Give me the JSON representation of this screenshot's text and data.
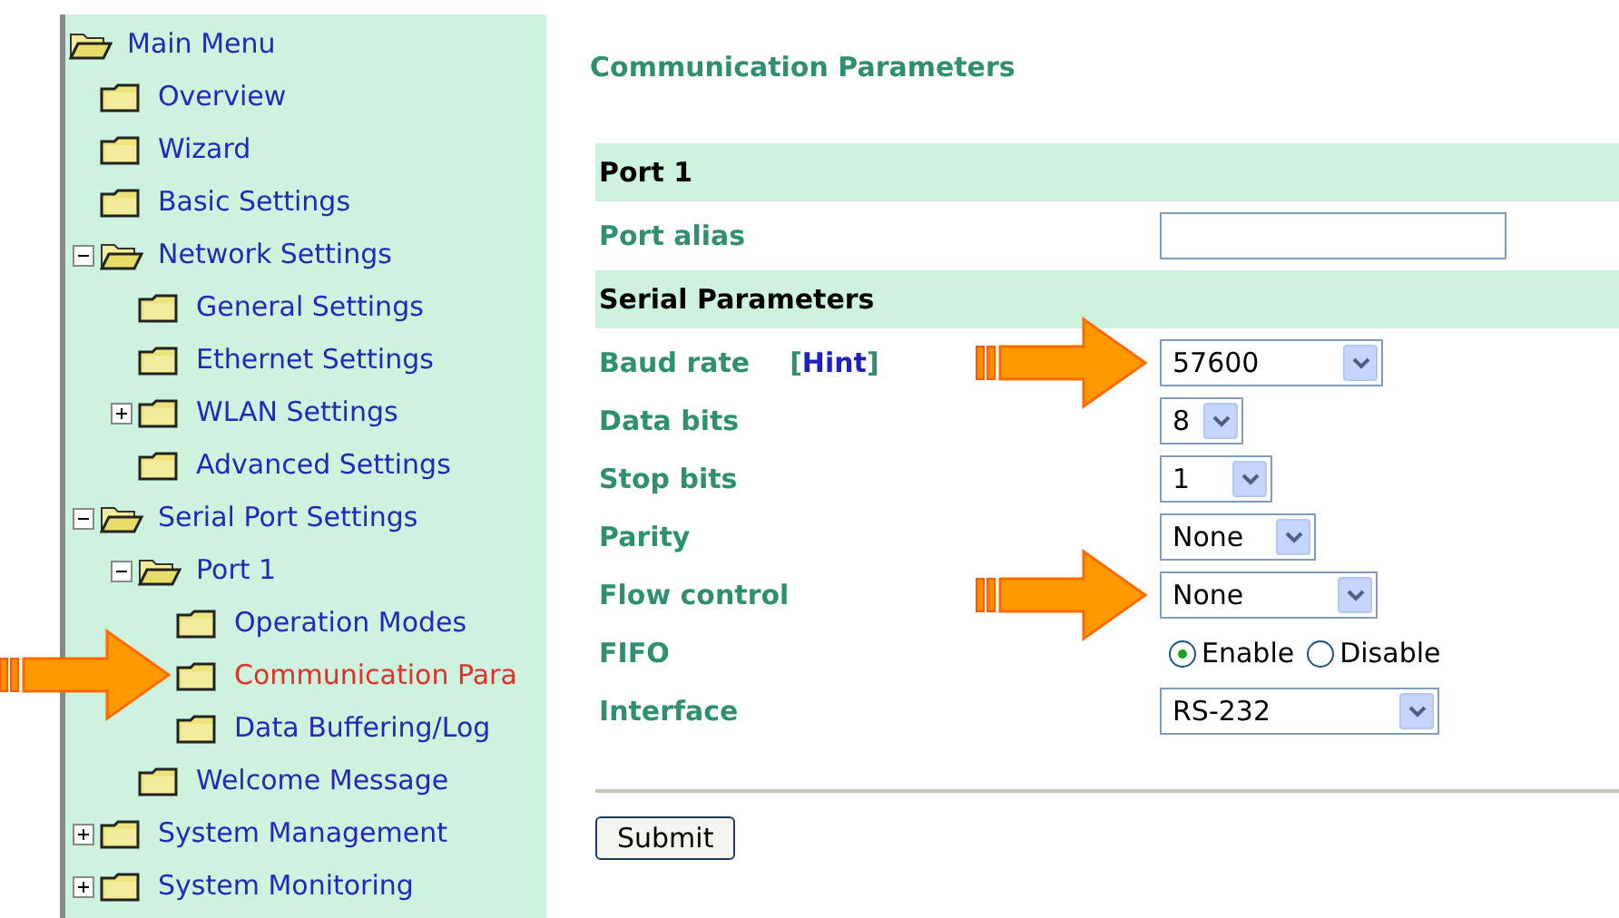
{
  "sidebar": {
    "tree": [
      {
        "label": "Main Menu",
        "kind": "root",
        "selected": false,
        "arrow": false,
        "children": [
          {
            "label": "Overview",
            "kind": "leaf",
            "selected": false,
            "arrow": false
          },
          {
            "label": "Wizard",
            "kind": "leaf",
            "selected": false,
            "arrow": false
          },
          {
            "label": "Basic Settings",
            "kind": "leaf",
            "selected": false,
            "arrow": false
          },
          {
            "label": "Network Settings",
            "kind": "branch",
            "expanded": true,
            "selected": false,
            "arrow": false,
            "children": [
              {
                "label": "General Settings",
                "kind": "leaf",
                "selected": false,
                "arrow": false
              },
              {
                "label": "Ethernet Settings",
                "kind": "leaf",
                "selected": false,
                "arrow": false
              },
              {
                "label": "WLAN Settings",
                "kind": "branch",
                "expanded": false,
                "selected": false,
                "arrow": false
              },
              {
                "label": "Advanced Settings",
                "kind": "leaf",
                "selected": false,
                "arrow": false
              }
            ]
          },
          {
            "label": "Serial Port Settings",
            "kind": "branch",
            "expanded": true,
            "selected": false,
            "arrow": false,
            "children": [
              {
                "label": "Port 1",
                "kind": "branch",
                "expanded": true,
                "selected": false,
                "arrow": false,
                "children": [
                  {
                    "label": "Operation Modes",
                    "kind": "leaf",
                    "selected": false,
                    "arrow": false
                  },
                  {
                    "label": "Communication Para",
                    "kind": "leaf",
                    "selected": true,
                    "arrow": true
                  },
                  {
                    "label": "Data Buffering/Log",
                    "kind": "leaf",
                    "selected": false,
                    "arrow": false
                  }
                ]
              },
              {
                "label": "Welcome Message",
                "kind": "leaf",
                "selected": false,
                "arrow": false
              }
            ]
          },
          {
            "label": "System Management",
            "kind": "branch",
            "expanded": false,
            "selected": false,
            "arrow": false
          },
          {
            "label": "System Monitoring",
            "kind": "branch",
            "expanded": false,
            "selected": false,
            "arrow": false
          }
        ]
      }
    ]
  },
  "main": {
    "title": "Communication Parameters",
    "rows": [
      {
        "kind": "section",
        "label": "Port 1"
      },
      {
        "kind": "text",
        "label": "Port alias",
        "value": "",
        "arrow": false
      },
      {
        "kind": "section",
        "label": "Serial Parameters"
      },
      {
        "kind": "select",
        "label": "Baud rate",
        "hint": {
          "open": "[",
          "text": "Hint",
          "close": "]"
        },
        "value": "57600",
        "arrow": true
      },
      {
        "kind": "select",
        "label": "Data bits",
        "value": "8",
        "arrow": false
      },
      {
        "kind": "select",
        "label": "Stop bits",
        "value": "1",
        "arrow": false
      },
      {
        "kind": "select",
        "label": "Parity",
        "value": "None",
        "arrow": false
      },
      {
        "kind": "select",
        "label": "Flow control",
        "value": "None",
        "arrow": true
      },
      {
        "kind": "radio",
        "label": "FIFO",
        "arrow": false,
        "options": [
          {
            "label": "Enable",
            "selected": true
          },
          {
            "label": "Disable",
            "selected": false
          }
        ]
      },
      {
        "kind": "select",
        "label": "Interface",
        "value": "RS-232",
        "arrow": false
      }
    ],
    "submit": "Submit"
  }
}
